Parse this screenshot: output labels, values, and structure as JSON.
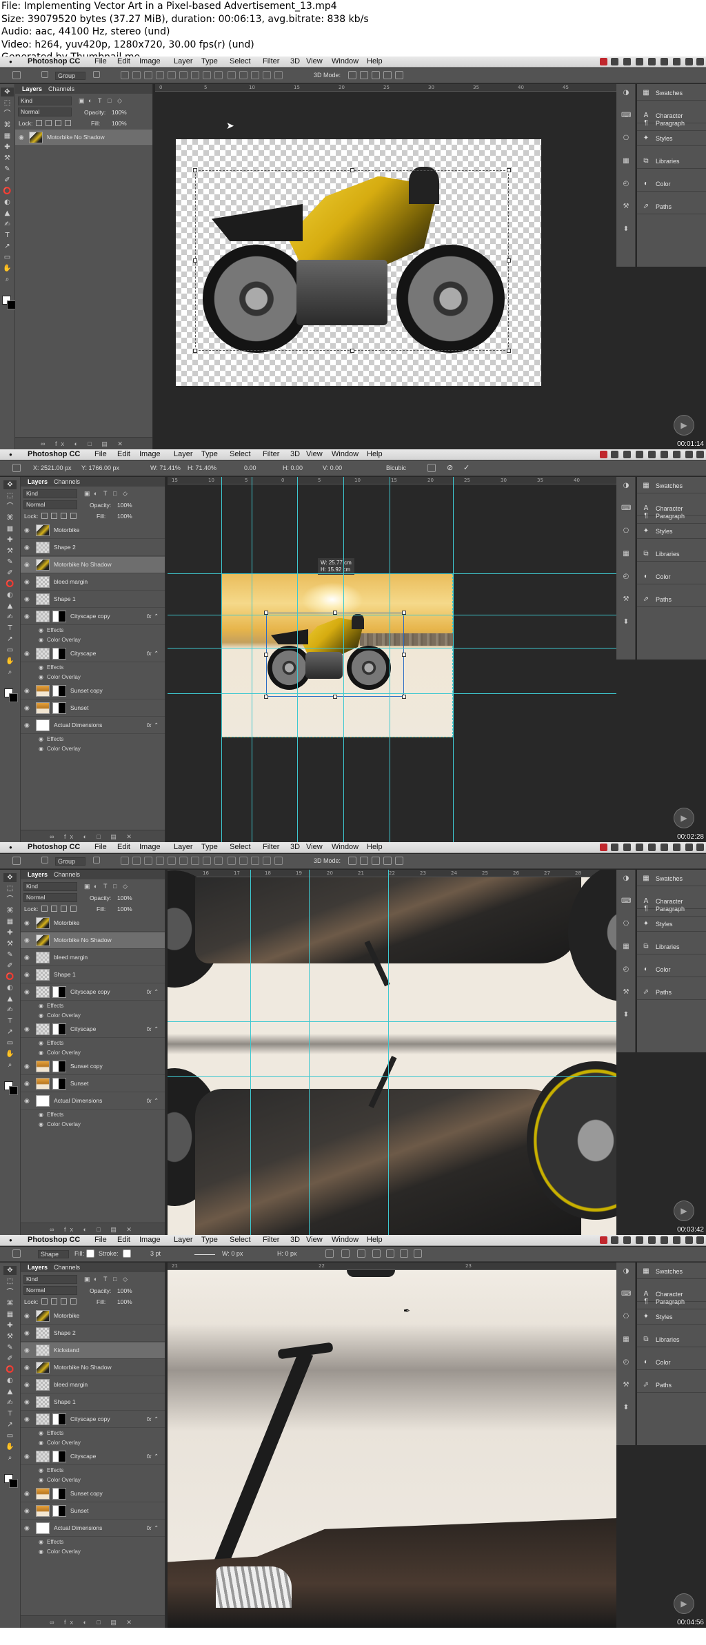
{
  "header": {
    "file_line": "File: Implementing Vector Art in a Pixel-based Advertisement_13.mp4",
    "size_line": "Size: 39079520 bytes (37.27 MiB), duration: 00:06:13, avg.bitrate: 838 kb/s",
    "audio_line": "Audio: aac, 44100 Hz, stereo (und)",
    "video_line": "Video: h264, yuv420p, 1280x720, 30.00 fps(r) (und)",
    "generated_line": "Generated by Thumbnail me"
  },
  "menubar": {
    "apple": "",
    "app_name": "Photoshop CC",
    "items": [
      "File",
      "Edit",
      "Image",
      "Layer",
      "Type",
      "Select",
      "Filter",
      "3D",
      "View",
      "Window",
      "Help"
    ]
  },
  "right_panels": [
    "Swatches",
    "Character",
    "Paragraph",
    "Styles",
    "Libraries",
    "Color",
    "Paths"
  ],
  "layers_panel": {
    "tabs": [
      "Layers",
      "Channels"
    ],
    "kind": "Kind",
    "blend_mode": "Normal",
    "opacity_label": "Opacity:",
    "opacity_value": "100%",
    "lock_label": "Lock:",
    "fill_label": "Fill:",
    "fill_value": "100%",
    "effects_label": "Effects",
    "color_overlay_label": "Color Overlay"
  },
  "frames": [
    {
      "timestamp": "00:01:14",
      "options": {
        "group": "Group",
        "mode_3d": "3D Mode:"
      },
      "ruler": [
        "0",
        "5",
        "10",
        "15",
        "20",
        "25",
        "30",
        "35",
        "40",
        "45"
      ],
      "layers": [
        {
          "name": "Motorbike No Shadow",
          "type": "moto",
          "selected": true
        }
      ]
    },
    {
      "timestamp": "00:02:28",
      "options": {
        "x": "X: 2521.00 px",
        "y": "Y: 1766.00 px",
        "w": "W: 71.41%",
        "h": "H: 71.40%",
        "angle": "0.00",
        "hskew": "H: 0.00",
        "vskew": "V: 0.00",
        "interp": "Bicubic"
      },
      "dimension_tip": {
        "w": "W: 25.77 cm",
        "h": "H: 15.92 cm"
      },
      "ruler": [
        "15",
        "10",
        "5",
        "0",
        "5",
        "10",
        "15",
        "20",
        "25",
        "30",
        "35",
        "40"
      ],
      "layers": [
        {
          "name": "Motorbike",
          "type": "moto"
        },
        {
          "name": "Shape 2",
          "type": "checker"
        },
        {
          "name": "Motorbike No Shadow",
          "type": "moto",
          "selected": true
        },
        {
          "name": "bleed margin",
          "type": "checker"
        },
        {
          "name": "Shape 1",
          "type": "checker"
        },
        {
          "name": "Cityscape copy",
          "type": "checker",
          "mask": true,
          "fx": true,
          "effects": true
        },
        {
          "name": "Cityscape",
          "type": "checker",
          "mask": true,
          "fx": true,
          "effects": true
        },
        {
          "name": "Sunset copy",
          "type": "sunset",
          "mask": true
        },
        {
          "name": "Sunset",
          "type": "sunset",
          "mask": true
        },
        {
          "name": "Actual Dimensions",
          "type": "white",
          "fx": true,
          "effects": true
        }
      ]
    },
    {
      "timestamp": "00:03:42",
      "options": {
        "group": "Group",
        "mode_3d": "3D Mode:"
      },
      "ruler": [
        "15",
        "16",
        "17",
        "18",
        "19",
        "20",
        "21",
        "22",
        "23",
        "24",
        "25",
        "26",
        "27",
        "28"
      ],
      "layers": [
        {
          "name": "Motorbike",
          "type": "moto"
        },
        {
          "name": "Motorbike No Shadow",
          "type": "moto",
          "selected": true
        },
        {
          "name": "bleed margin",
          "type": "checker"
        },
        {
          "name": "Shape 1",
          "type": "checker"
        },
        {
          "name": "Cityscape copy",
          "type": "checker",
          "mask": true,
          "fx": true,
          "effects": true
        },
        {
          "name": "Cityscape",
          "type": "checker",
          "mask": true,
          "fx": true,
          "effects": true
        },
        {
          "name": "Sunset copy",
          "type": "sunset",
          "mask": true
        },
        {
          "name": "Sunset",
          "type": "sunset",
          "mask": true
        },
        {
          "name": "Actual Dimensions",
          "type": "white",
          "fx": true,
          "effects": true
        }
      ]
    },
    {
      "timestamp": "00:04:56",
      "options": {
        "shape": "Shape",
        "fill": "Fill:",
        "stroke": "Stroke:",
        "stroke_size": "3 pt",
        "w": "W: 0 px",
        "h": "H: 0 px"
      },
      "ruler": [
        "21",
        "22",
        "23"
      ],
      "layers": [
        {
          "name": "Motorbike",
          "type": "moto"
        },
        {
          "name": "Shape 2",
          "type": "checker"
        },
        {
          "name": "Kickstand",
          "type": "checker",
          "selected": true
        },
        {
          "name": "Motorbike No Shadow",
          "type": "moto"
        },
        {
          "name": "bleed margin",
          "type": "checker"
        },
        {
          "name": "Shape 1",
          "type": "checker"
        },
        {
          "name": "Cityscape copy",
          "type": "checker",
          "mask": true,
          "fx": true,
          "effects": true
        },
        {
          "name": "Cityscape",
          "type": "checker",
          "mask": true,
          "fx": true,
          "effects": true
        },
        {
          "name": "Sunset copy",
          "type": "sunset",
          "mask": true
        },
        {
          "name": "Sunset",
          "type": "sunset",
          "mask": true
        },
        {
          "name": "Actual Dimensions",
          "type": "white",
          "fx": true,
          "effects": true
        }
      ]
    }
  ],
  "colors": {
    "guide": "#3ec8d0",
    "panel": "#535353",
    "workspace": "#282828",
    "selection": "#6e6e6e"
  }
}
